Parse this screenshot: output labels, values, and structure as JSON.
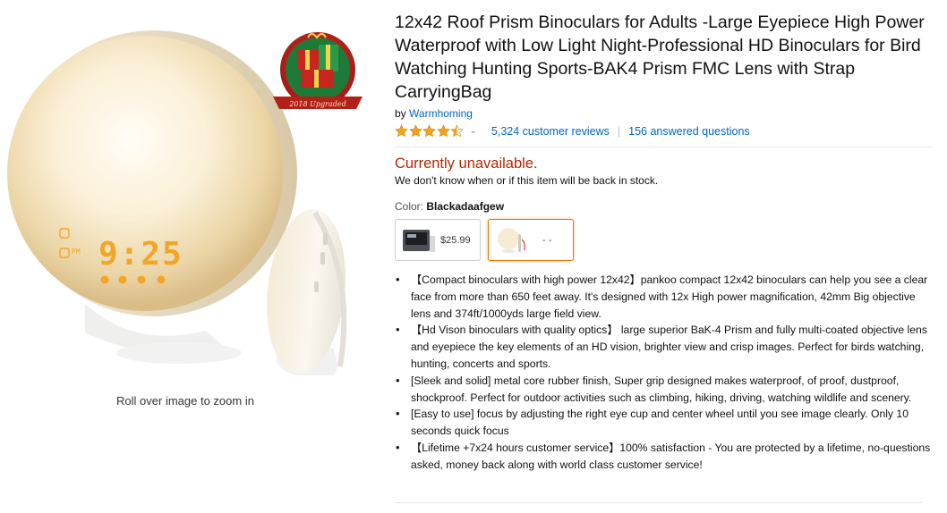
{
  "product": {
    "title": "12x42 Roof Prism Binoculars for Adults -Large Eyepiece High Power Waterproof with Low Light Night-Professional HD Binoculars for Bird Watching Hunting Sports-BAK4 Prism FMC Lens with Strap CarryingBag",
    "by_label": "by",
    "brand": "Warmhoming",
    "rating": 4.5,
    "reviews_link": "5,324 customer reviews",
    "questions_link": "156 answered questions",
    "rating_separator": "|",
    "chevron": "⌄"
  },
  "image": {
    "zoom_hint": "Roll over image to zoom in",
    "clock_display": "9:25",
    "badge_text": "2018 Upgraded"
  },
  "availability": {
    "status": "Currently unavailable.",
    "note": "We don't know when or if this item will be back in stock."
  },
  "color": {
    "label": "Color:",
    "selected": "Blackadaafgew",
    "options": [
      {
        "price": "$25.99"
      },
      {
        "price": "- -"
      }
    ]
  },
  "features": [
    "【Compact binoculars with high power 12x42】pankoo compact 12x42 binoculars can help you see a clear face from more than 650 feet away. It's designed with 12x High power magnification, 42mm Big objective lens and 374ft/1000yds large field view.",
    "【Hd Vison binoculars with quality optics】 large superior BaK-4 Prism and fully multi-coated objective lens and eyepiece the key elements of an HD vision, brighter view and crisp images. Perfect for birds watching, hunting, concerts and sports.",
    "[Sleek and solid] metal core rubber finish, Super grip designed makes waterproof, of proof, dustproof, shockproof. Perfect for outdoor activities such as climbing, hiking, driving, watching wildlife and scenery.",
    "[Easy to use] focus by adjusting the right eye cup and center wheel until you see image clearly. Only 10 seconds quick focus",
    "【Lifetime +7x24 hours customer service】100% satisfaction - You are protected by a lifetime, no-questions asked, money back along with world class customer service!"
  ],
  "colors": {
    "link": "#0066c0",
    "price_red": "#b12704",
    "star": "#f4a41c",
    "swatch_selected": "#e77600"
  }
}
